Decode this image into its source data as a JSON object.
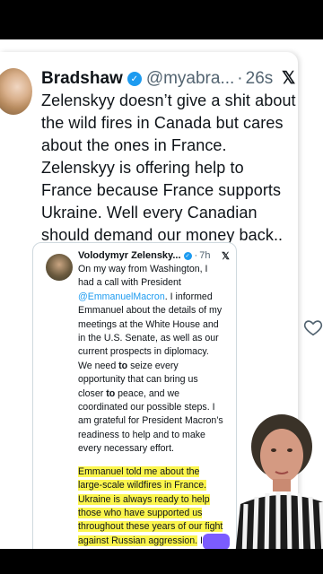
{
  "post": {
    "display_name": "Bradshaw",
    "handle": "@myabra...",
    "separator": "·",
    "time": "26s",
    "text": "Zelenskyy doesn’t give a shit about the wild fires in Canada but cares about the ones in France. Zelenskyy is offering help to France because France supports Ukraine. Well every Canadian should demand our money back.."
  },
  "quoted_post": {
    "display_name": "Volodymyr Zelensky...",
    "separator": "·",
    "time": "7h",
    "p1_a": "On my way from Washington, I had a call with President ",
    "p1_mention": "@EmmanuelMacron",
    "p1_b": ". I informed Emmanuel about the details of my meetings at the White House and in the U.S. Senate, as well as our current prospects in diplomacy. We need ",
    "p1_bold1": "to",
    "p1_c": " seize every opportunity that can bring us closer ",
    "p1_bold2": "to",
    "p1_d": " peace, and we coordinated our possible steps. I am grateful for President Macron’s readiness to help and to make every necessary effort.",
    "p2_highlight": "Emmanuel told me about the large-scale wildfires in France. Ukraine is always ready to help those who have supported us throughout these years of our fight against Russian aggression.",
    "p2_rest": " I offered France our assistance. Our specialists can join the firefighting efforts."
  },
  "icons": {
    "verified": "verified-badge-icon",
    "x_logo": "x-logo-icon",
    "like": "heart-icon"
  },
  "colors": {
    "accent": "#1d9bf0",
    "highlight": "#fbf54d"
  }
}
